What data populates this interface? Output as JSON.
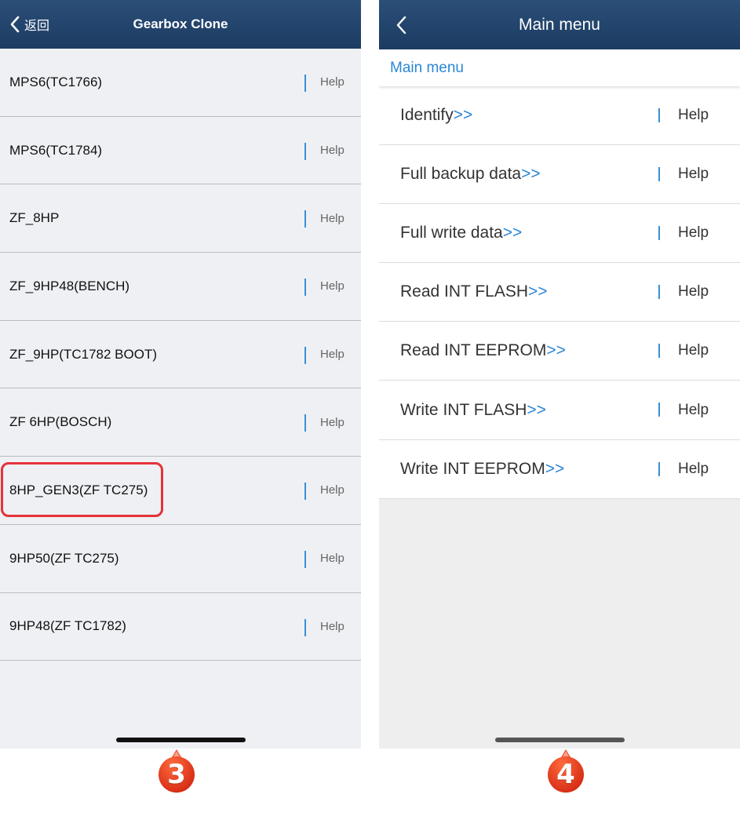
{
  "left_screen": {
    "back_label": "返回",
    "title": "Gearbox Clone",
    "items": [
      {
        "label": "MPS6(TC1766)",
        "help": "Help"
      },
      {
        "label": "MPS6(TC1784)",
        "help": "Help"
      },
      {
        "label": "ZF_8HP",
        "help": "Help"
      },
      {
        "label": "ZF_9HP48(BENCH)",
        "help": "Help"
      },
      {
        "label": "ZF_9HP(TC1782 BOOT)",
        "help": "Help"
      },
      {
        "label": "ZF 6HP(BOSCH)",
        "help": "Help"
      },
      {
        "label": "8HP_GEN3(ZF TC275)",
        "help": "Help"
      },
      {
        "label": "9HP50(ZF TC275)",
        "help": "Help"
      },
      {
        "label": "9HP48(ZF TC1782)",
        "help": "Help"
      }
    ],
    "step_number": "3"
  },
  "right_screen": {
    "title": "Main menu",
    "breadcrumb": "Main menu",
    "items": [
      {
        "label": "Identify",
        "arrow": ">>",
        "help": "Help"
      },
      {
        "label": "Full backup data",
        "arrow": ">>",
        "help": "Help"
      },
      {
        "label": "Full write data",
        "arrow": ">>",
        "help": "Help"
      },
      {
        "label": "Read INT FLASH",
        "arrow": ">>",
        "help": "Help"
      },
      {
        "label": "Read INT EEPROM",
        "arrow": ">>",
        "help": "Help"
      },
      {
        "label": "Write INT FLASH",
        "arrow": ">>",
        "help": "Help"
      },
      {
        "label": "Write INT EEPROM",
        "arrow": ">>",
        "help": "Help"
      }
    ],
    "step_number": "4"
  },
  "icons": {
    "back": "chevron-left-icon",
    "step_badge": "map-pin-badge-icon"
  },
  "colors": {
    "navbar": "#1c3b62",
    "accent_blue": "#2b86d4",
    "highlight_red": "#e53239",
    "badge_red": "#e0321f"
  }
}
